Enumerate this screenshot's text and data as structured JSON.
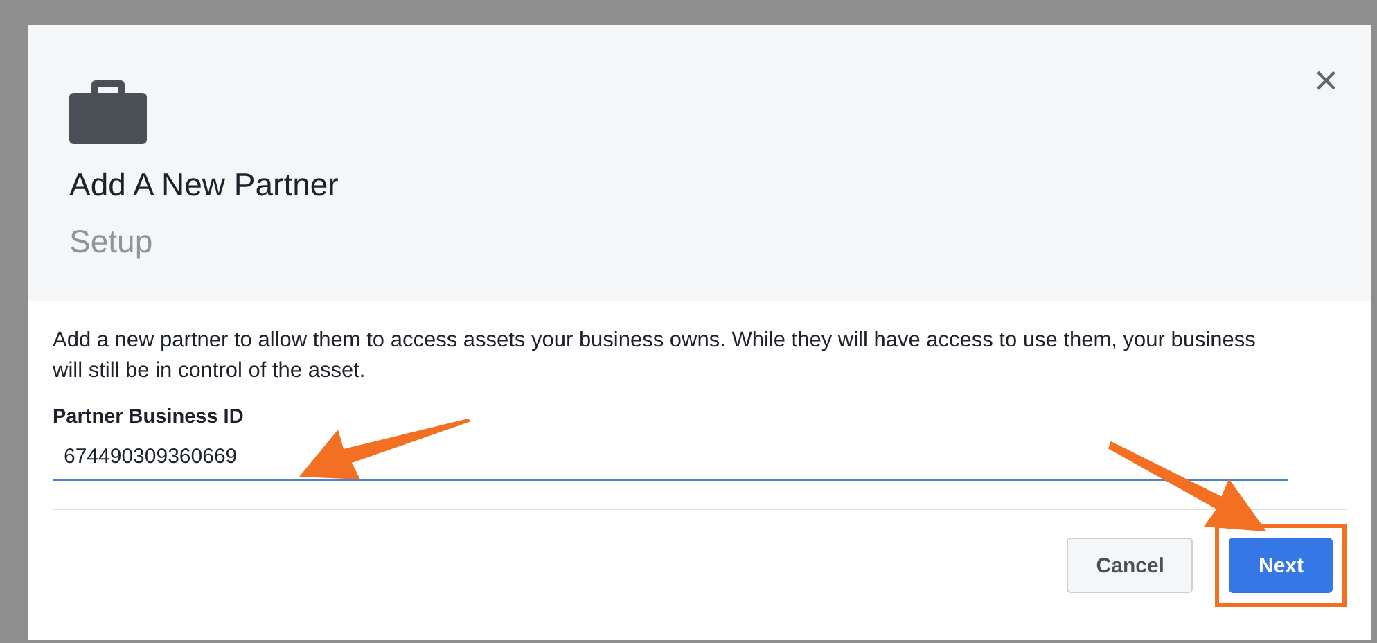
{
  "dialog": {
    "title": "Add A New Partner",
    "subtitle": "Setup",
    "close": "×",
    "description": "Add a new partner to allow them to access assets your business owns. While they will have access to use them, your business will still be in control of the asset.",
    "field": {
      "label": "Partner Business ID",
      "value": "674490309360669"
    },
    "buttons": [
      {
        "label": "Cancel",
        "kind": "secondary",
        "highlighted": false
      },
      {
        "label": "Next",
        "kind": "primary",
        "highlighted": true
      }
    ]
  }
}
